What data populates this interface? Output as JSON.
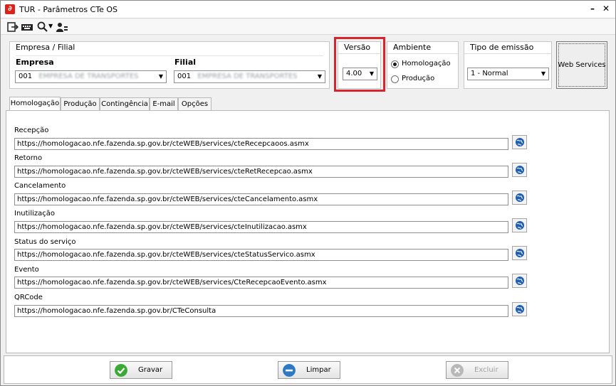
{
  "window": {
    "title": "TUR - Parâmetros CTe OS"
  },
  "toolbar": {
    "icons": [
      "exit-icon",
      "keyboard-icon",
      "search-icon",
      "user-icon"
    ]
  },
  "empresa_filial": {
    "section_title": "Empresa / Filial",
    "empresa_label": "Empresa",
    "empresa_value": "001",
    "empresa_name_blurred": "EMPRESA DE TRANSPORTES ASSOC...",
    "filial_label": "Filial",
    "filial_value": "001",
    "filial_name_blurred": "EMPRESA DE TRANSPORTES ASSOC..."
  },
  "versao": {
    "title": "Versão",
    "value": "4.00"
  },
  "ambiente": {
    "title": "Ambiente",
    "options": [
      "Homologação",
      "Produção"
    ],
    "selected": "Homologação"
  },
  "tipo_emissao": {
    "title": "Tipo de emissão",
    "value": "1 - Normal"
  },
  "web_services_button": "Web Services",
  "tabs": [
    "Homologação",
    "Produção",
    "Contingência",
    "E-mail",
    "Opções"
  ],
  "fields": [
    {
      "label": "Recepção",
      "value": "https://homologacao.nfe.fazenda.sp.gov.br/cteWEB/services/cteRecepcaoos.asmx"
    },
    {
      "label": "Retorno",
      "value": "https://homologacao.nfe.fazenda.sp.gov.br/cteWEB/services/cteRetRecepcao.asmx"
    },
    {
      "label": "Cancelamento",
      "value": "https://homologacao.nfe.fazenda.sp.gov.br/cteWEB/services/cteCancelamento.asmx"
    },
    {
      "label": "Inutilização",
      "value": "https://homologacao.nfe.fazenda.sp.gov.br/cteWEB/services/cteInutilizacao.asmx"
    },
    {
      "label": "Status do serviço",
      "value": "https://homologacao.nfe.fazenda.sp.gov.br/cteWEB/services/cteStatusServico.asmx"
    },
    {
      "label": "Evento",
      "value": "https://homologacao.nfe.fazenda.sp.gov.br/cteWEB/services/CteRecepcaoEvento.asmx"
    },
    {
      "label": "QRCode",
      "value": "https://homologacao.nfe.fazenda.sp.gov.br/CTeConsulta"
    }
  ],
  "buttons": {
    "gravar": "Gravar",
    "limpar": "Limpar",
    "excluir": "Excluir"
  },
  "colors": {
    "highlight": "#d8252d",
    "gravar": "#3aa935",
    "limpar": "#2f78c4",
    "excluir": "#b8b8b8"
  }
}
